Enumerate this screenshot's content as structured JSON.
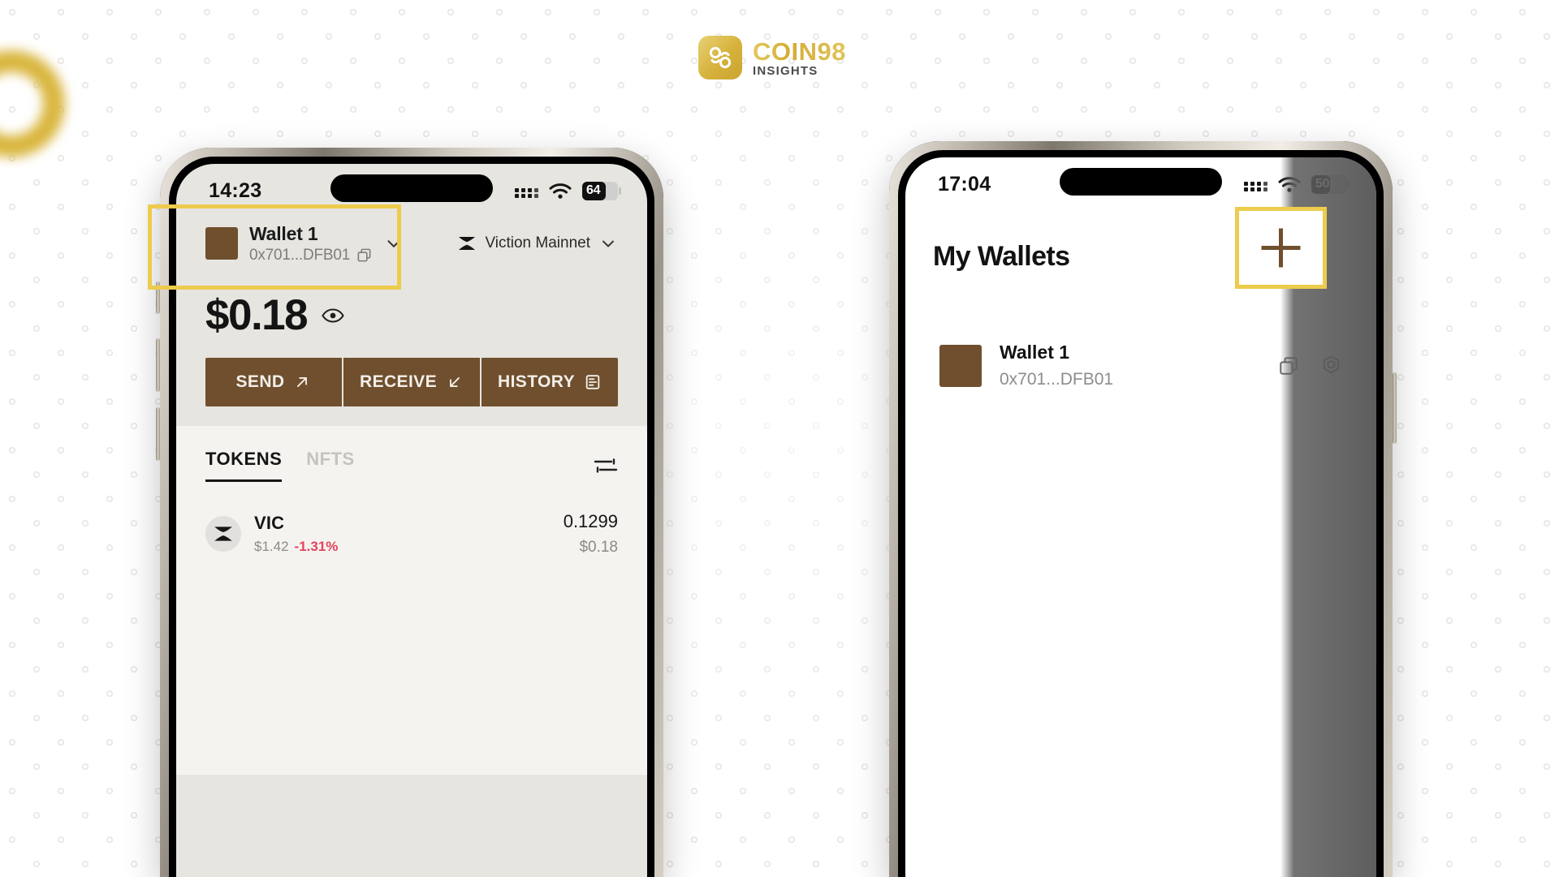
{
  "brand": {
    "name": "COIN98",
    "subtitle": "INSIGHTS",
    "logo_icon": "coin98-logo-icon",
    "accent_color": "#d4ac35"
  },
  "colors": {
    "highlight": "#edcb4d",
    "brown": "#6f4f2e",
    "negative": "#e4435e",
    "screen_left_bg": "#e7e5e0",
    "screen_right_bg": "#ffffff"
  },
  "left_phone": {
    "status": {
      "time": "14:23",
      "signal_icon": "signal-bars-icon",
      "wifi_icon": "wifi-icon",
      "battery_icon": "battery-icon",
      "battery_level": "64"
    },
    "wallet_selector": {
      "avatar": "wallet-avatar",
      "name": "Wallet 1",
      "address": "0x701...DFB01",
      "copy_icon": "copy-icon",
      "chevron_icon": "chevron-down-icon"
    },
    "network": {
      "icon": "viction-network-icon",
      "name": "Viction Mainnet",
      "chevron_icon": "chevron-down-icon"
    },
    "balance": {
      "amount": "$0.18",
      "eye_icon": "eye-icon"
    },
    "actions": [
      {
        "label": "SEND",
        "icon": "arrow-up-right-icon"
      },
      {
        "label": "RECEIVE",
        "icon": "arrow-down-left-icon"
      },
      {
        "label": "HISTORY",
        "icon": "history-list-icon"
      }
    ],
    "tabs": [
      {
        "label": "TOKENS",
        "active": true
      },
      {
        "label": "NFTS",
        "active": false
      }
    ],
    "filter_icon": "filter-sliders-icon",
    "tokens": [
      {
        "icon": "vic-token-icon",
        "symbol": "VIC",
        "price": "$1.42",
        "change": "-1.31%",
        "amount": "0.1299",
        "value": "$0.18"
      }
    ]
  },
  "right_phone": {
    "status": {
      "time": "17:04",
      "signal_icon": "signal-bars-icon",
      "wifi_icon": "wifi-icon",
      "battery_icon": "battery-icon",
      "battery_level": "50"
    },
    "title": "My Wallets",
    "add_wallet_icon": "plus-icon",
    "wallets": [
      {
        "avatar": "wallet-avatar",
        "name": "Wallet 1",
        "address": "0x701...DFB01",
        "copy_icon": "copy-icon",
        "settings_icon": "settings-hex-icon"
      }
    ]
  }
}
